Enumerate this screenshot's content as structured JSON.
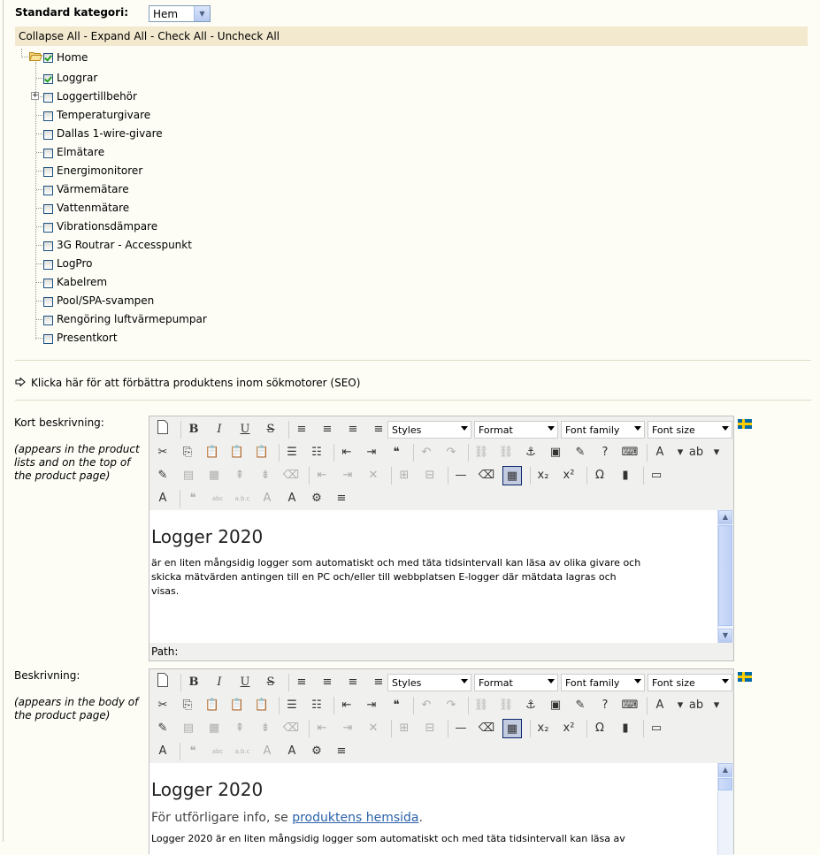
{
  "standard_category": {
    "label": "Standard kategori:",
    "selected": "Hem"
  },
  "tree_actions": {
    "collapse_all": "Collapse All",
    "expand_all": "Expand All",
    "check_all": "Check All",
    "uncheck_all": "Uncheck All",
    "separator": " - "
  },
  "tree": {
    "root": {
      "label": "Home",
      "checked": true
    },
    "items": [
      {
        "label": "Loggrar",
        "checked": true,
        "expandable": false
      },
      {
        "label": "Loggertillbehör",
        "checked": false,
        "expandable": true
      },
      {
        "label": "Temperaturgivare",
        "checked": false,
        "expandable": false
      },
      {
        "label": "Dallas 1-wire-givare",
        "checked": false,
        "expandable": false
      },
      {
        "label": "Elmätare",
        "checked": false,
        "expandable": false
      },
      {
        "label": "Energimonitorer",
        "checked": false,
        "expandable": false
      },
      {
        "label": "Värmemätare",
        "checked": false,
        "expandable": false
      },
      {
        "label": "Vattenmätare",
        "checked": false,
        "expandable": false
      },
      {
        "label": "Vibrationsdämpare",
        "checked": false,
        "expandable": false
      },
      {
        "label": "3G Routrar - Accesspunkt",
        "checked": false,
        "expandable": false
      },
      {
        "label": "LogPro",
        "checked": false,
        "expandable": false
      },
      {
        "label": "Kabelrem",
        "checked": false,
        "expandable": false
      },
      {
        "label": "Pool/SPA-svampen",
        "checked": false,
        "expandable": false
      },
      {
        "label": "Rengöring luftvärmepumpar",
        "checked": false,
        "expandable": false
      },
      {
        "label": "Presentkort",
        "checked": false,
        "expandable": false
      }
    ]
  },
  "seo_link": "Klicka här för att förbättra produktens inom sökmotorer (SEO)",
  "short_description": {
    "label": "Kort beskrivning:",
    "help": "(appears in the product lists and on the top of the product page)",
    "heading": "Logger 2020",
    "body": "är en liten mångsidig logger som automatiskt och med täta tidsintervall kan läsa av olika givare och skicka mätvärden antingen till en PC och/eller till webbplatsen E-logger där mätdata lagras och visas.",
    "path_label": "Path:"
  },
  "description": {
    "label": "Beskrivning:",
    "help": "(appears in the body of the product page)",
    "heading": "Logger 2020",
    "info_prefix": "För utförligare info, se ",
    "info_link": "produktens hemsida",
    "info_suffix": ".",
    "body_start": "Logger 2020 är en liten mångsidig logger som automatiskt och med täta tidsintervall kan läsa av"
  },
  "toolbar": {
    "styles": "Styles",
    "format": "Format",
    "font_family": "Font family",
    "font_size": "Font size"
  },
  "language_flag": "swedish-flag-icon"
}
